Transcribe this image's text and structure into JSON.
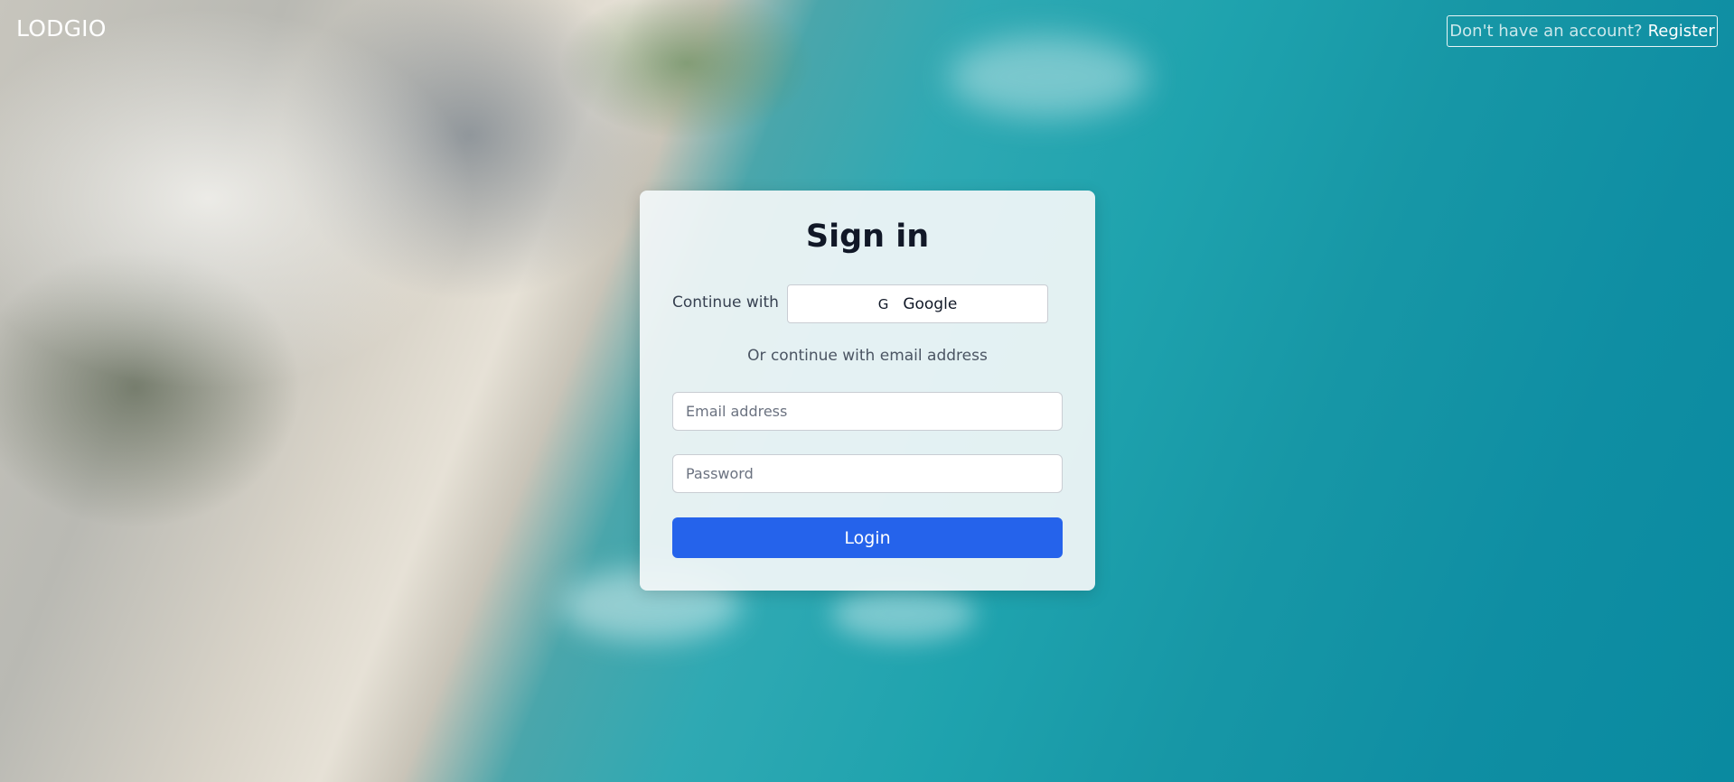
{
  "brand": {
    "logo_text": "LODGIO"
  },
  "header": {
    "register_prompt": "Don't have an account?",
    "register_link": "Register"
  },
  "signin": {
    "title": "Sign in",
    "continue_with_label": "Continue with",
    "google_icon_glyph": "G",
    "google_label": "Google",
    "divider_text": "Or continue with email address",
    "email_placeholder": "Email address",
    "email_value": "",
    "password_placeholder": "Password",
    "password_value": "",
    "login_label": "Login"
  },
  "colors": {
    "primary": "#2563eb",
    "card_bg": "#f2f6f8",
    "text_dark": "#111827"
  },
  "icons": {
    "google": "google-icon"
  }
}
